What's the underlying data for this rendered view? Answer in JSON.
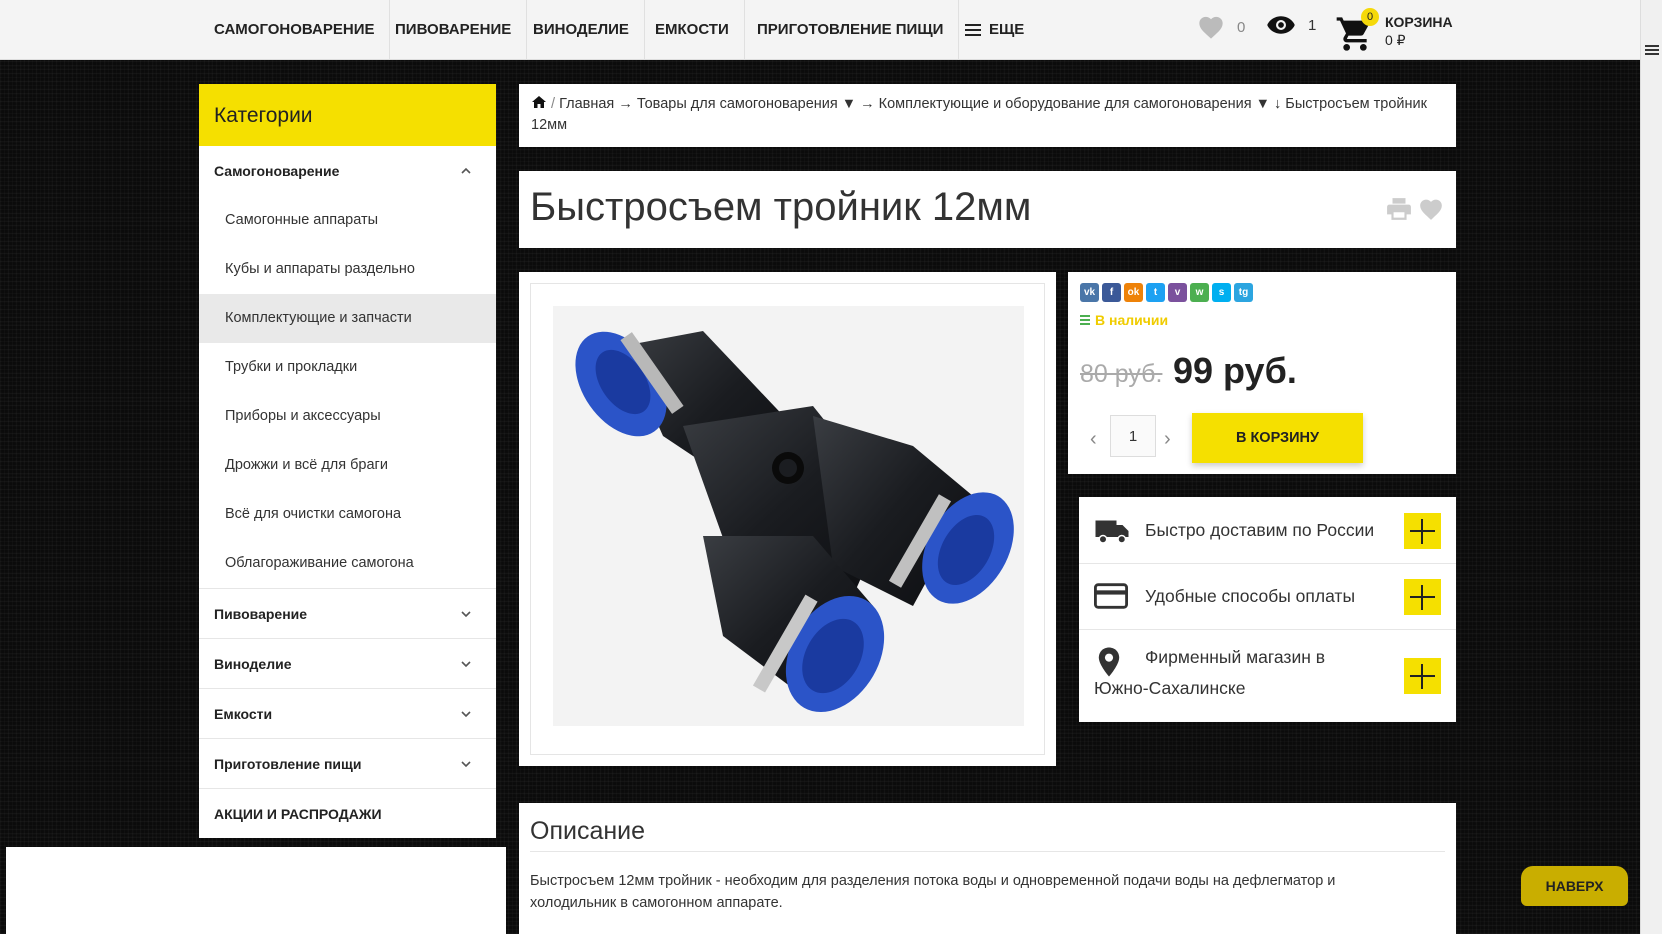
{
  "nav": {
    "items": [
      "Самогоноварение",
      "Пивоварение",
      "Виноделие",
      "Емкости",
      "Приготовление пищи"
    ],
    "more_label": "Еще",
    "favorites_count": "0",
    "views_count": "1",
    "cart_badge": "0",
    "cart_title": "КОРЗИНА",
    "cart_sum": "0 ₽"
  },
  "sidebar": {
    "title": "Категории",
    "section_open": "Самогоноварение",
    "subitems": [
      "Самогонные аппараты",
      "Кубы и аппараты раздельно",
      "Комплектующие и запчасти",
      "Трубки и прокладки",
      "Приборы и аксессуары",
      "Дрожжи и всё для браги",
      "Всё для очистки самогона",
      "Облагораживание самогона"
    ],
    "sections": [
      "Пивоварение",
      "Виноделие",
      "Емкости",
      "Приготовление пищи"
    ],
    "promo": "АКЦИИ И РАСПРОДАЖИ"
  },
  "breadcrumb": {
    "home": "Главная",
    "arrow1": "→",
    "level1": "Товары для самогоноварения",
    "dd1": "▼",
    "arrow2": "→",
    "level2": "Комплектующие и оборудование для самогоноварения",
    "dd2": "▼",
    "arrow3": "↓",
    "current": "Быстросъем тройник 12мм"
  },
  "product": {
    "title": "Быстросъем тройник 12мм",
    "stock": "В наличии",
    "old_price": "80 руб.",
    "price": "99 руб.",
    "qty": "1",
    "to_cart": "В корзину",
    "shares": [
      {
        "name": "vk",
        "label": "vk",
        "color": "#4a76a8"
      },
      {
        "name": "facebook",
        "label": "f",
        "color": "#3b5998"
      },
      {
        "name": "odnoklassniki",
        "label": "ok",
        "color": "#ee8208"
      },
      {
        "name": "twitter",
        "label": "t",
        "color": "#1da1f2"
      },
      {
        "name": "viber",
        "label": "v",
        "color": "#7b519d"
      },
      {
        "name": "whatsapp",
        "label": "w",
        "color": "#4caf50"
      },
      {
        "name": "skype",
        "label": "s",
        "color": "#00aff0"
      },
      {
        "name": "telegram",
        "label": "tg",
        "color": "#2ca5e0"
      }
    ]
  },
  "info": {
    "delivery": "Быстро доставим по России",
    "payment": "Удобные способы оплаты",
    "store_line1": "Фирменный магазин в",
    "store_line2": "Южно-Сахалинске"
  },
  "description": {
    "title": "Описание",
    "text_line1": "Быстросъем 12мм тройник - необходим для разделения потока воды и одновременной подачи воды на дефлегматор и",
    "text_line2": "холодильник в самогонном аппарате."
  },
  "up_button": "НАВЕРХ",
  "colors": {
    "accent": "#f5e000",
    "background": "#0b0b0b"
  }
}
